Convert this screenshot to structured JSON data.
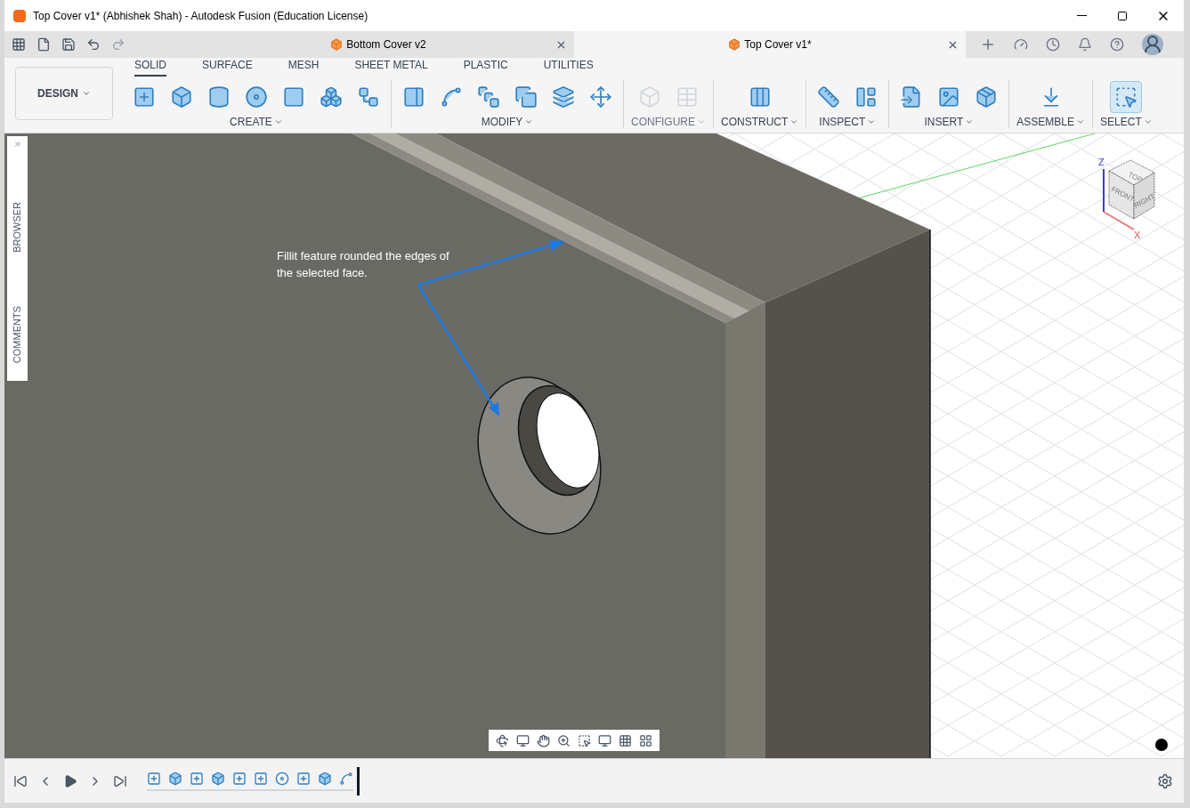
{
  "window": {
    "title": "Top Cover v1* (Abhishek Shah) - Autodesk Fusion (Education License)"
  },
  "document_tabs": [
    {
      "label": "Bottom Cover v2",
      "selected": false
    },
    {
      "label": "Top Cover v1*",
      "selected": true
    }
  ],
  "workspace": {
    "label": "DESIGN"
  },
  "toolbar_tabs": [
    {
      "label": "SOLID",
      "selected": true
    },
    {
      "label": "SURFACE",
      "selected": false
    },
    {
      "label": "MESH",
      "selected": false
    },
    {
      "label": "SHEET METAL",
      "selected": false
    },
    {
      "label": "PLASTIC",
      "selected": false
    },
    {
      "label": "UTILITIES",
      "selected": false
    }
  ],
  "tool_groups": [
    {
      "label": "CREATE",
      "disabled": false
    },
    {
      "label": "MODIFY",
      "disabled": false
    },
    {
      "label": "CONFIGURE",
      "disabled": true
    },
    {
      "label": "CONSTRUCT",
      "disabled": false
    },
    {
      "label": "INSPECT",
      "disabled": false
    },
    {
      "label": "INSERT",
      "disabled": false
    },
    {
      "label": "ASSEMBLE",
      "disabled": false
    },
    {
      "label": "SELECT",
      "disabled": false
    }
  ],
  "side_panel": [
    "BROWSER",
    "COMMENTS"
  ],
  "annotation": "Fillit feature rounded the edges of the selected face.",
  "view_cube": {
    "faces": [
      "TOP",
      "FRONT",
      "RIGHT"
    ],
    "axes": [
      "Z",
      "X"
    ]
  }
}
